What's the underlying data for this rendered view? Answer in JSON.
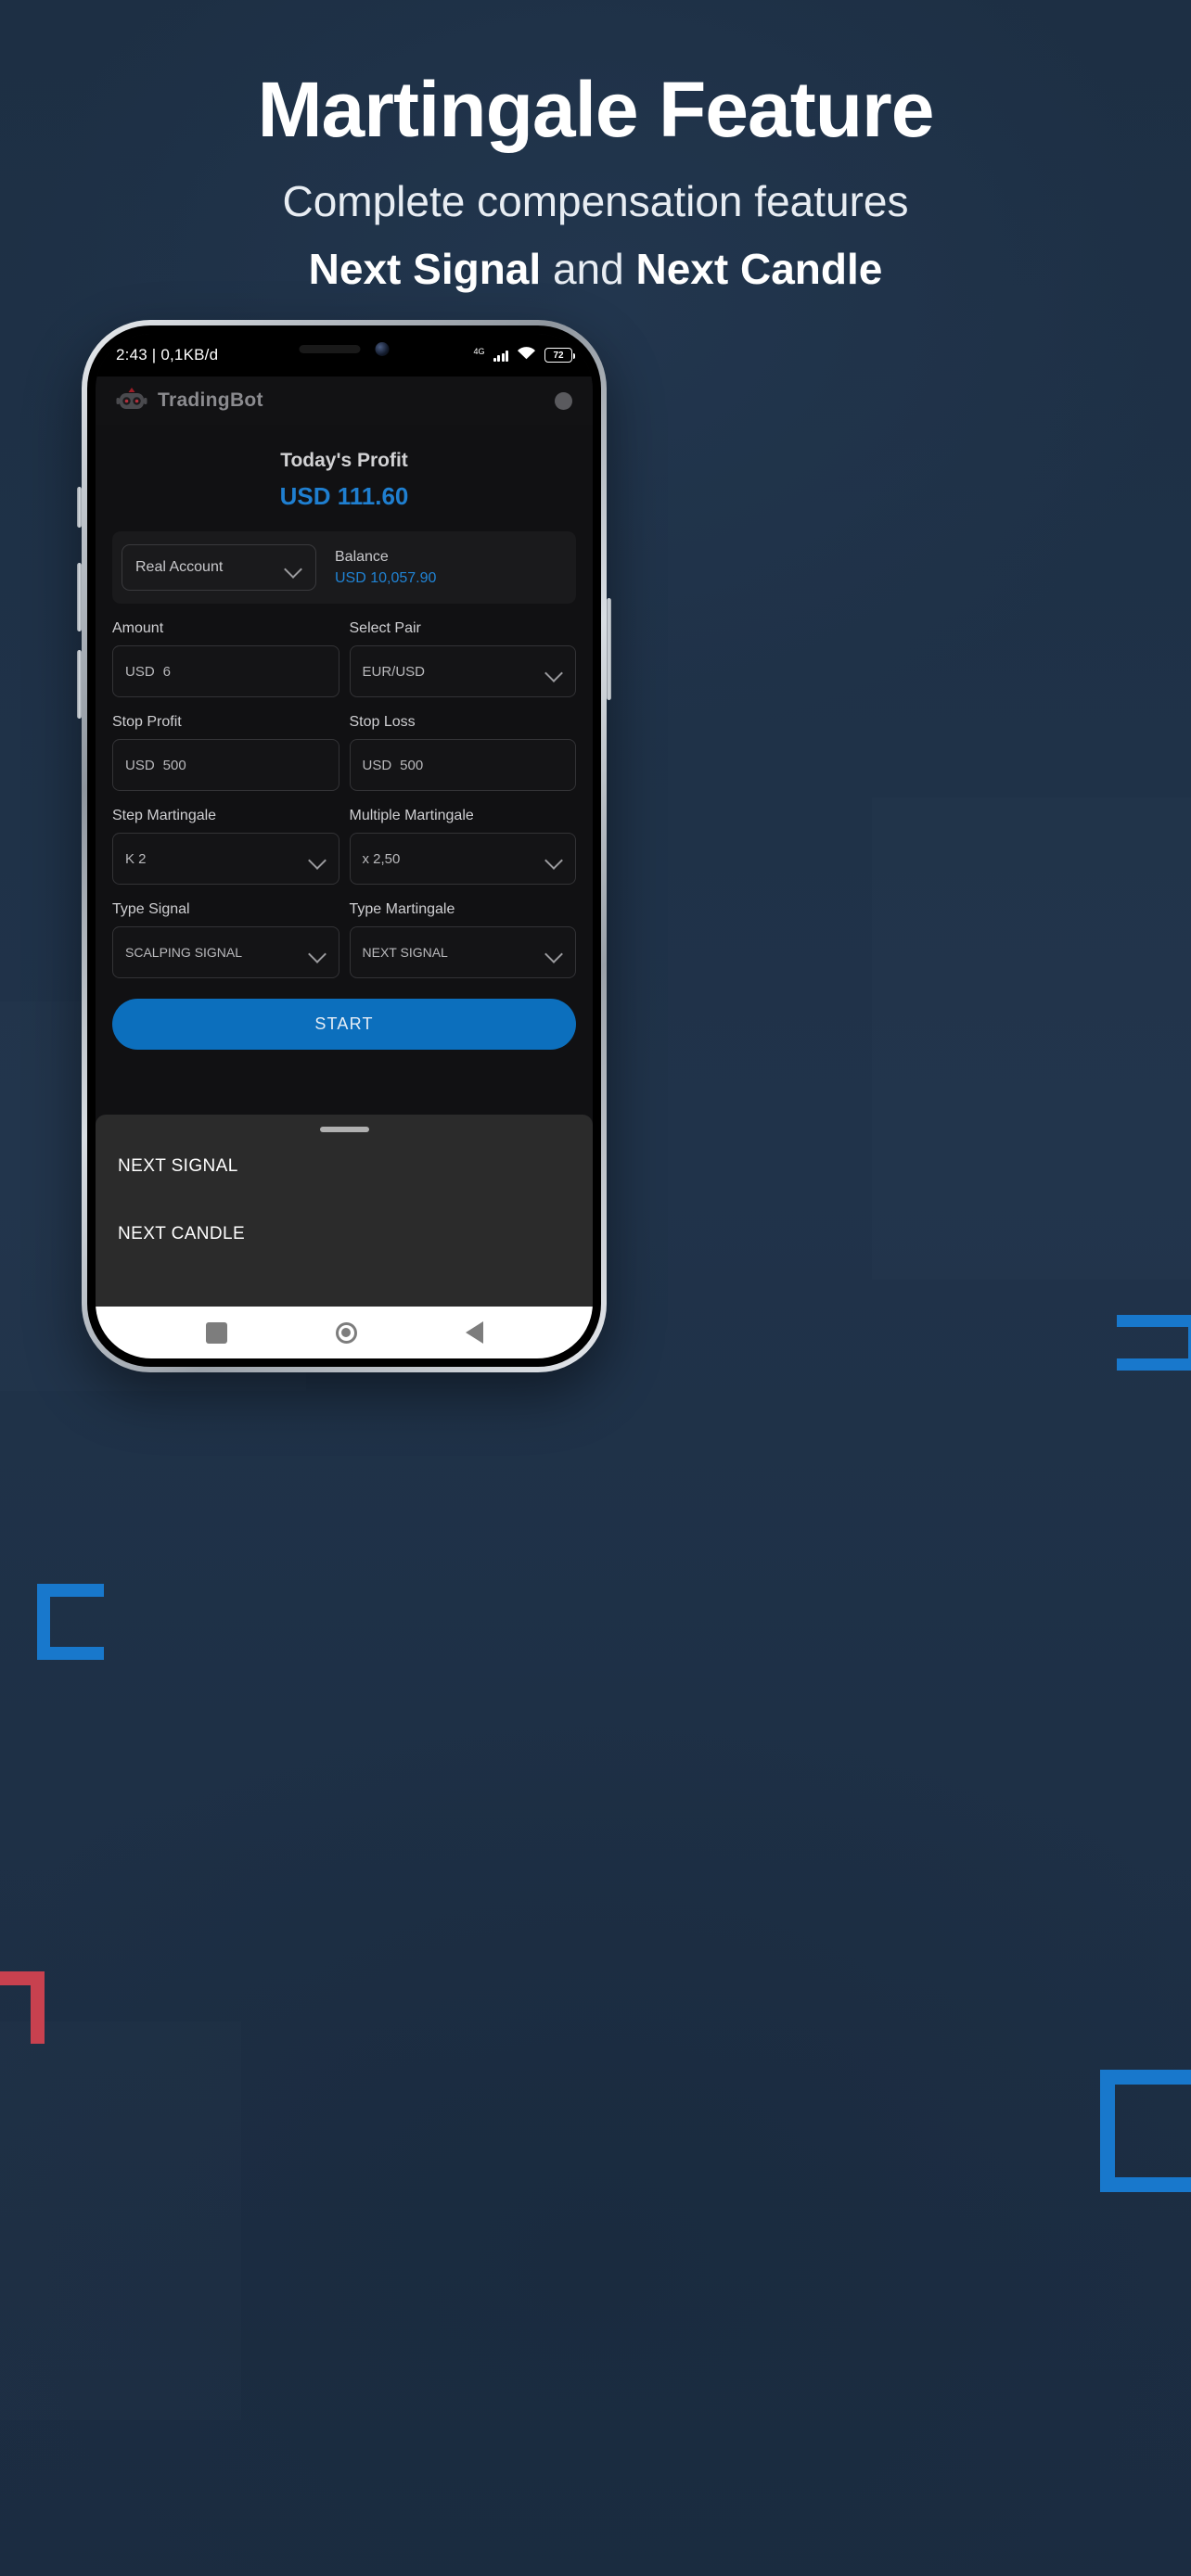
{
  "promo": {
    "title": "Martingale Feature",
    "subtitle_line1": "Complete compensation features",
    "subtitle_strong1": "Next Signal",
    "subtitle_mid": " and ",
    "subtitle_strong2": "Next Candle"
  },
  "colors": {
    "page_bg": "#1e3046",
    "accent_blue": "#1c7fd6",
    "bracket_blue": "#1878cc",
    "bracket_red": "#c8414f",
    "app_bg": "#111113",
    "sheet_bg": "#2b2b2b",
    "button_blue": "#0c6fbd"
  },
  "status_bar": {
    "time_and_data": "2:43 | 0,1KB/d",
    "network_type": "4G",
    "battery_percent": "72"
  },
  "app_header": {
    "title": "TradingBot"
  },
  "profit": {
    "label": "Today's Profit",
    "value": "USD 111.60"
  },
  "account": {
    "selected": "Real Account",
    "balance_label": "Balance",
    "balance_value": "USD 10,057.90"
  },
  "fields": {
    "amount": {
      "label": "Amount",
      "unit": "USD",
      "value": "6"
    },
    "select_pair": {
      "label": "Select Pair",
      "value": "EUR/USD"
    },
    "stop_profit": {
      "label": "Stop Profit",
      "unit": "USD",
      "value": "500"
    },
    "stop_loss": {
      "label": "Stop Loss",
      "unit": "USD",
      "value": "500"
    },
    "step_martingale": {
      "label": "Step Martingale",
      "value": "K 2"
    },
    "multiple_martingale": {
      "label": "Multiple Martingale",
      "value": "x 2,50"
    },
    "type_signal": {
      "label": "Type Signal",
      "value": "SCALPING SIGNAL"
    },
    "type_martingale": {
      "label": "Type Martingale",
      "value": "NEXT SIGNAL"
    }
  },
  "start_button": {
    "label": "START"
  },
  "bottom_sheet": {
    "options": [
      {
        "label": "NEXT SIGNAL"
      },
      {
        "label": "NEXT CANDLE"
      }
    ]
  },
  "android_nav": {
    "recents": "recents",
    "home": "home",
    "back": "back"
  }
}
